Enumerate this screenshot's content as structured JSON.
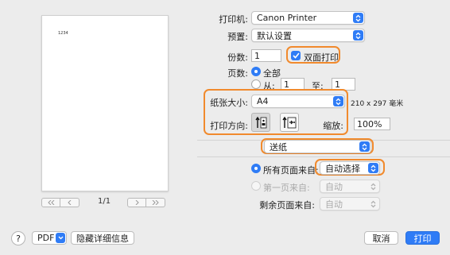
{
  "preview": {
    "page_text": "1234",
    "page_indicator": "1/1"
  },
  "printer": {
    "label": "打印机:",
    "value": "Canon Printer"
  },
  "presets": {
    "label": "预置:",
    "value": "默认设置"
  },
  "copies": {
    "label": "份数:",
    "value": "1",
    "two_sided_label": "双面打印",
    "two_sided_checked": true
  },
  "pages": {
    "label": "页数:",
    "all_label": "全部",
    "from_label": "从:",
    "from_value": "1",
    "to_label": "至:",
    "to_value": "1"
  },
  "paper_size": {
    "label": "纸张大小:",
    "value": "A4",
    "dimensions": "210 x 297 毫米"
  },
  "orientation": {
    "label": "打印方向:",
    "scale_label": "缩放:",
    "scale_value": "100%"
  },
  "section": {
    "value": "送纸"
  },
  "feed": {
    "all_pages_label": "所有页面来自:",
    "all_pages_value": "自动选择",
    "first_page_label": "第一页来自:",
    "first_page_value": "自动",
    "remaining_label": "剩余页面来自:",
    "remaining_value": "自动"
  },
  "footer": {
    "help": "?",
    "pdf_label": "PDF",
    "hide_details": "隐藏详细信息",
    "cancel": "取消",
    "print": "打印"
  },
  "colors": {
    "accent": "#2f7cf6",
    "highlight": "#f18a2d"
  }
}
